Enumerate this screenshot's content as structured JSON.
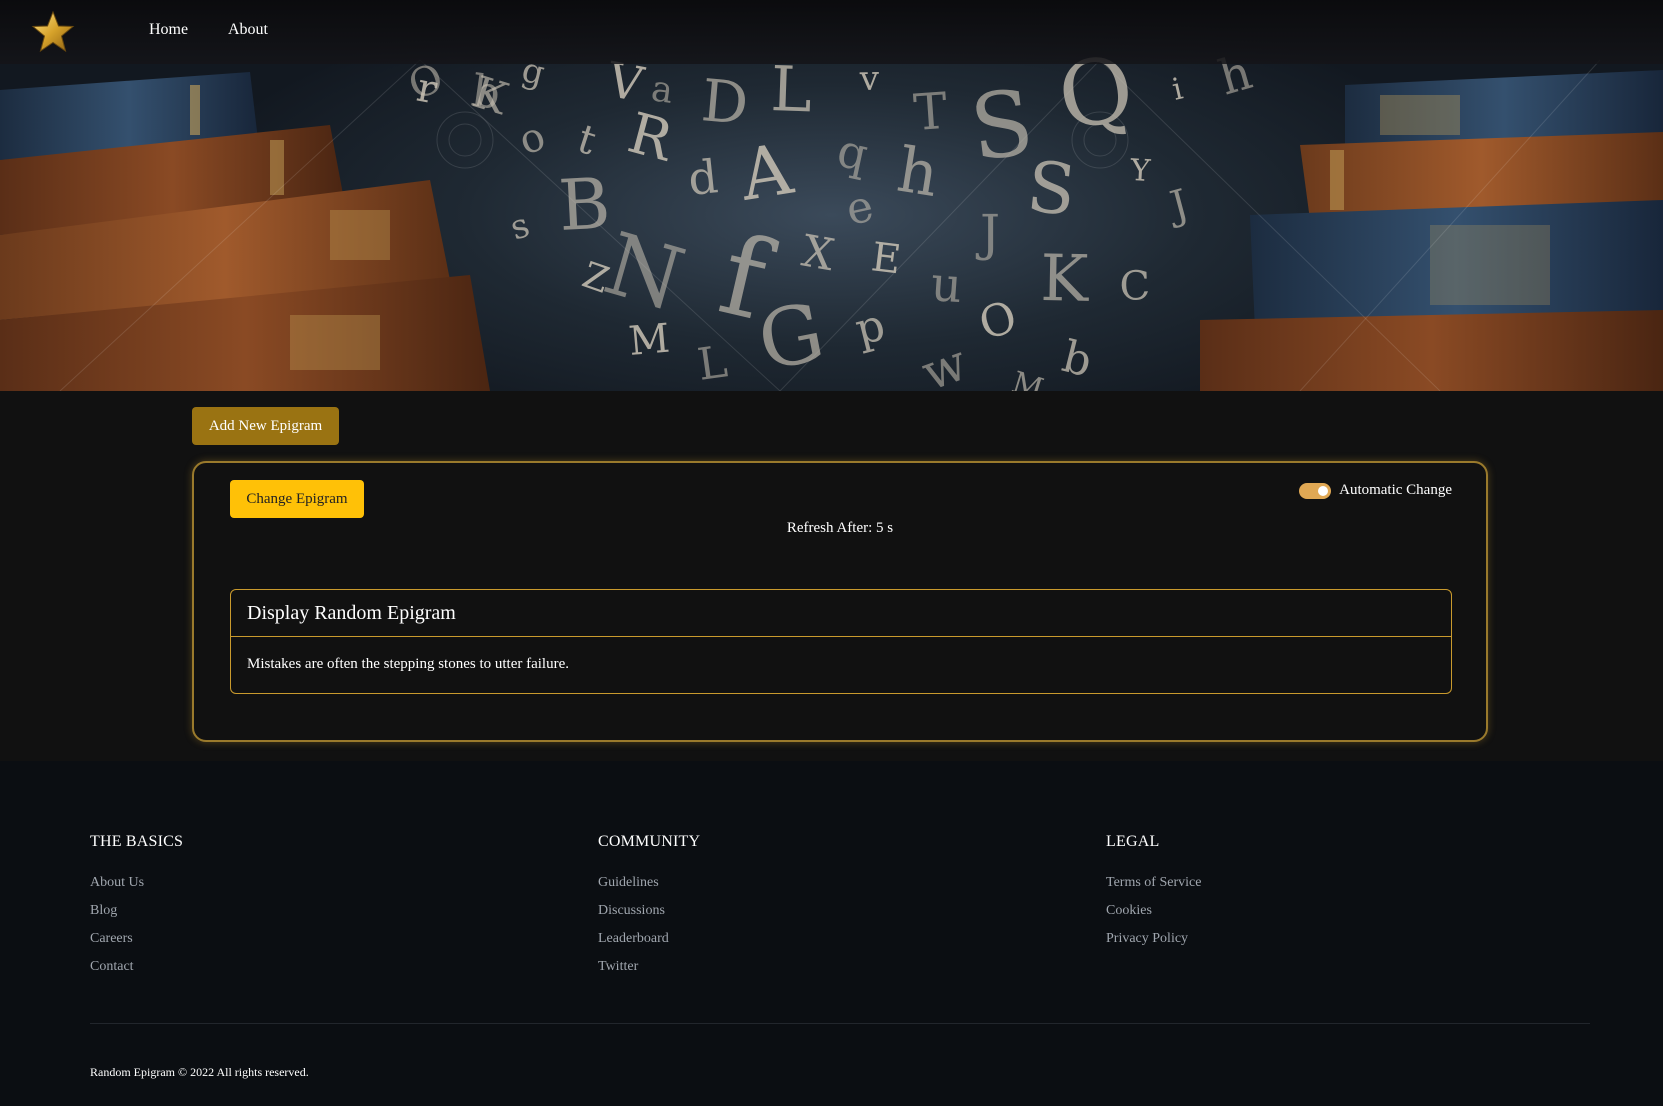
{
  "nav": {
    "logo_icon": "star-icon",
    "links": [
      {
        "label": "Home"
      },
      {
        "label": "About"
      }
    ]
  },
  "hero": {
    "letters": [
      "O",
      "K",
      "g",
      "V",
      "a",
      "D",
      "L",
      "v",
      "T",
      "S",
      "Q",
      "i",
      "h",
      "o",
      "t",
      "R",
      "q",
      "h",
      "S",
      "Y",
      "J",
      "B",
      "d",
      "A",
      "e",
      "J",
      "s",
      "Z",
      "N",
      "f",
      "X",
      "E",
      "u",
      "K",
      "C",
      "M",
      "L",
      "G",
      "p",
      "O",
      "w",
      "M",
      "b",
      "r",
      "b"
    ]
  },
  "actions": {
    "add_button": "Add New Epigram",
    "change_button": "Change Epigram",
    "auto_change_label": "Automatic Change",
    "auto_change_on": true,
    "refresh_text": "Refresh After: 5 s"
  },
  "epigram": {
    "title": "Display Random Epigram",
    "text": "Mistakes are often the stepping stones to utter failure."
  },
  "footer": {
    "columns": [
      {
        "heading": "THE BASICS",
        "links": [
          "About Us",
          "Blog",
          "Careers",
          "Contact"
        ]
      },
      {
        "heading": "COMMUNITY",
        "links": [
          "Guidelines",
          "Discussions",
          "Leaderboard",
          "Twitter"
        ]
      },
      {
        "heading": "LEGAL",
        "links": [
          "Terms of Service",
          "Cookies",
          "Privacy Policy"
        ]
      }
    ],
    "copyright": "Random Epigram © 2022 All rights reserved."
  },
  "colors": {
    "accent_gold": "#9a7312",
    "accent_yellow": "#ffc107",
    "border_gold": "#c99a2d",
    "toggle_on": "#e0a854"
  }
}
